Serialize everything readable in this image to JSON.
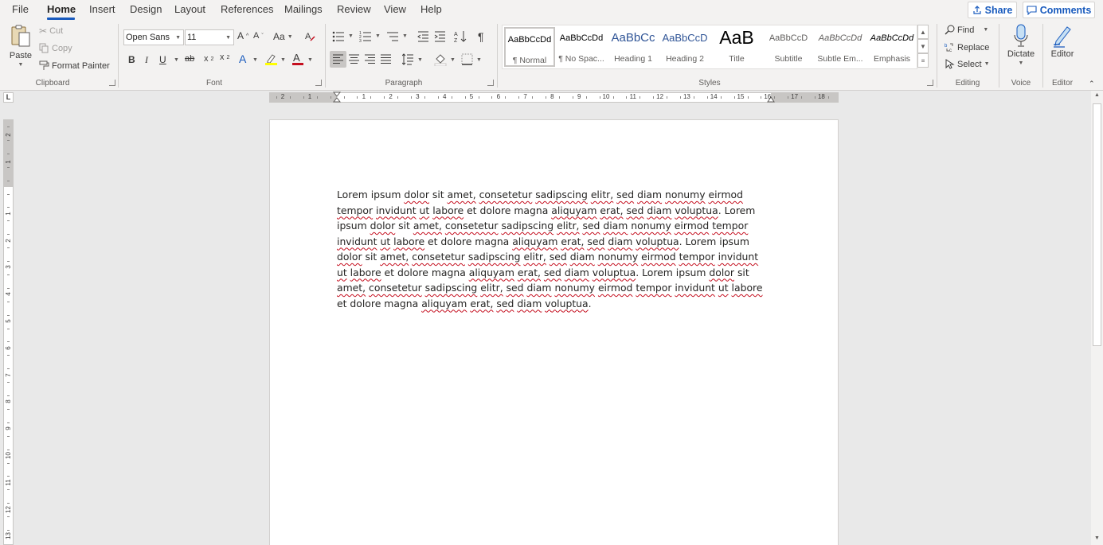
{
  "menu": {
    "tabs": [
      "File",
      "Home",
      "Insert",
      "Design",
      "Layout",
      "References",
      "Mailings",
      "Review",
      "View",
      "Help"
    ],
    "active_tab": "Home",
    "share_label": "Share",
    "comments_label": "Comments"
  },
  "ribbon": {
    "clipboard": {
      "paste_label": "Paste",
      "cut_label": "Cut",
      "copy_label": "Copy",
      "format_painter_label": "Format Painter",
      "group_label": "Clipboard"
    },
    "font": {
      "font_name": "Open Sans",
      "font_size": "11",
      "change_case_label": "Aa",
      "group_label": "Font",
      "accent_highlight": "#ffff00",
      "accent_font_color": "#c50f1f",
      "accent_text_effects": "#185abd"
    },
    "paragraph": {
      "group_label": "Paragraph"
    },
    "styles": {
      "group_label": "Styles",
      "items": [
        {
          "sample": "AaBbCcDd",
          "name": "¶ Normal"
        },
        {
          "sample": "AaBbCcDd",
          "name": "¶ No Spac..."
        },
        {
          "sample": "AaBbCc",
          "name": "Heading 1"
        },
        {
          "sample": "AaBbCcD",
          "name": "Heading 2"
        },
        {
          "sample": "AaB",
          "name": "Title"
        },
        {
          "sample": "AaBbCcD",
          "name": "Subtitle"
        },
        {
          "sample": "AaBbCcDd",
          "name": "Subtle Em..."
        },
        {
          "sample": "AaBbCcDd",
          "name": "Emphasis"
        }
      ]
    },
    "editing": {
      "find_label": "Find",
      "replace_label": "Replace",
      "select_label": "Select",
      "group_label": "Editing"
    },
    "voice": {
      "dictate_label": "Dictate",
      "group_label": "Voice"
    },
    "editor": {
      "editor_label": "Editor",
      "group_label": "Editor"
    }
  },
  "ruler": {
    "h_left_numbers": [
      "2",
      "1"
    ],
    "h_numbers": [
      "1",
      "2",
      "3",
      "4",
      "5",
      "6",
      "7",
      "8",
      "9",
      "10",
      "11",
      "12",
      "13",
      "14",
      "15",
      "16",
      "17",
      "18"
    ],
    "v_top_numbers": [
      "2",
      "1"
    ],
    "v_numbers": [
      "1",
      "2",
      "3",
      "4",
      "5",
      "6",
      "7",
      "8",
      "9",
      "10",
      "11",
      "12",
      "13"
    ],
    "tab_selector": "L"
  },
  "document": {
    "segments": [
      {
        "t": "Lorem ipsum "
      },
      {
        "t": "dolor",
        "s": true
      },
      {
        "t": " sit "
      },
      {
        "t": "amet,",
        "s": true
      },
      {
        "t": " "
      },
      {
        "t": "consetetur",
        "s": true
      },
      {
        "t": " "
      },
      {
        "t": "sadipscing",
        "s": true
      },
      {
        "t": " "
      },
      {
        "t": "elitr,",
        "s": true
      },
      {
        "t": " "
      },
      {
        "t": "sed",
        "s": true
      },
      {
        "t": " "
      },
      {
        "t": "diam",
        "s": true
      },
      {
        "t": " "
      },
      {
        "t": "nonumy",
        "s": true
      },
      {
        "t": " "
      },
      {
        "t": "eirmod",
        "s": true
      },
      {
        "t": " "
      },
      {
        "t": "tempor",
        "s": true
      },
      {
        "t": " "
      },
      {
        "t": "invidunt",
        "s": true
      },
      {
        "t": " "
      },
      {
        "t": "ut",
        "s": true
      },
      {
        "t": " "
      },
      {
        "t": "labore",
        "s": true
      },
      {
        "t": " et dolore magna "
      },
      {
        "t": "aliquyam",
        "s": true
      },
      {
        "t": " "
      },
      {
        "t": "erat,",
        "s": true
      },
      {
        "t": " "
      },
      {
        "t": "sed",
        "s": true
      },
      {
        "t": " "
      },
      {
        "t": "diam",
        "s": true
      },
      {
        "t": " "
      },
      {
        "t": "voluptua",
        "s": true
      },
      {
        "t": ". Lorem ipsum "
      },
      {
        "t": "dolor",
        "s": true
      },
      {
        "t": " sit "
      },
      {
        "t": "amet,",
        "s": true
      },
      {
        "t": " "
      },
      {
        "t": "consetetur",
        "s": true
      },
      {
        "t": " "
      },
      {
        "t": "sadipscing",
        "s": true
      },
      {
        "t": " "
      },
      {
        "t": "elitr,",
        "s": true
      },
      {
        "t": " "
      },
      {
        "t": "sed",
        "s": true
      },
      {
        "t": " "
      },
      {
        "t": "diam",
        "s": true
      },
      {
        "t": " "
      },
      {
        "t": "nonumy",
        "s": true
      },
      {
        "t": " "
      },
      {
        "t": "eirmod",
        "s": true
      },
      {
        "t": " "
      },
      {
        "t": "tempor",
        "s": true
      },
      {
        "t": " "
      },
      {
        "t": "invidunt",
        "s": true
      },
      {
        "t": " "
      },
      {
        "t": "ut",
        "s": true
      },
      {
        "t": " "
      },
      {
        "t": "labore",
        "s": true
      },
      {
        "t": " et dolore magna "
      },
      {
        "t": "aliquyam",
        "s": true
      },
      {
        "t": " "
      },
      {
        "t": "erat,",
        "s": true
      },
      {
        "t": " "
      },
      {
        "t": "sed",
        "s": true
      },
      {
        "t": " "
      },
      {
        "t": "diam",
        "s": true
      },
      {
        "t": " "
      },
      {
        "t": "voluptua",
        "s": true
      },
      {
        "t": ". Lorem ipsum "
      },
      {
        "t": "dolor",
        "s": true
      },
      {
        "t": " sit "
      },
      {
        "t": "amet,",
        "s": true
      },
      {
        "t": " "
      },
      {
        "t": "consetetur",
        "s": true
      },
      {
        "t": " "
      },
      {
        "t": "sadipscing",
        "s": true
      },
      {
        "t": " "
      },
      {
        "t": "elitr,",
        "s": true
      },
      {
        "t": " "
      },
      {
        "t": "sed",
        "s": true
      },
      {
        "t": " "
      },
      {
        "t": "diam",
        "s": true
      },
      {
        "t": " "
      },
      {
        "t": "nonumy",
        "s": true
      },
      {
        "t": " "
      },
      {
        "t": "eirmod",
        "s": true
      },
      {
        "t": " "
      },
      {
        "t": "tempor",
        "s": true
      },
      {
        "t": " "
      },
      {
        "t": "invidunt",
        "s": true
      },
      {
        "t": " "
      },
      {
        "t": "ut",
        "s": true
      },
      {
        "t": " "
      },
      {
        "t": "labore",
        "s": true
      },
      {
        "t": " et dolore magna "
      },
      {
        "t": "aliquyam",
        "s": true
      },
      {
        "t": " "
      },
      {
        "t": "erat,",
        "s": true
      },
      {
        "t": " "
      },
      {
        "t": "sed",
        "s": true
      },
      {
        "t": " "
      },
      {
        "t": "diam",
        "s": true
      },
      {
        "t": " "
      },
      {
        "t": "voluptua",
        "s": true
      },
      {
        "t": ". Lorem ipsum "
      },
      {
        "t": "dolor",
        "s": true
      },
      {
        "t": " sit "
      },
      {
        "t": "amet,",
        "s": true
      },
      {
        "t": " "
      },
      {
        "t": "consetetur",
        "s": true
      },
      {
        "t": " "
      },
      {
        "t": "sadipscing",
        "s": true
      },
      {
        "t": " "
      },
      {
        "t": "elitr,",
        "s": true
      },
      {
        "t": " "
      },
      {
        "t": "sed",
        "s": true
      },
      {
        "t": " "
      },
      {
        "t": "diam",
        "s": true
      },
      {
        "t": " "
      },
      {
        "t": "nonumy",
        "s": true
      },
      {
        "t": " "
      },
      {
        "t": "eirmod",
        "s": true
      },
      {
        "t": " "
      },
      {
        "t": "tempor",
        "s": true
      },
      {
        "t": " "
      },
      {
        "t": "invidunt",
        "s": true
      },
      {
        "t": " "
      },
      {
        "t": "ut",
        "s": true
      },
      {
        "t": " "
      },
      {
        "t": "labore",
        "s": true
      },
      {
        "t": " et dolore magna "
      },
      {
        "t": "aliquyam",
        "s": true
      },
      {
        "t": " "
      },
      {
        "t": "erat,",
        "s": true
      },
      {
        "t": " "
      },
      {
        "t": "sed",
        "s": true
      },
      {
        "t": " "
      },
      {
        "t": "diam",
        "s": true
      },
      {
        "t": " "
      },
      {
        "t": "voluptua",
        "s": true
      },
      {
        "t": "."
      }
    ]
  },
  "colors": {
    "accent": "#185abd",
    "spelling_underline": "#c50f1f"
  }
}
